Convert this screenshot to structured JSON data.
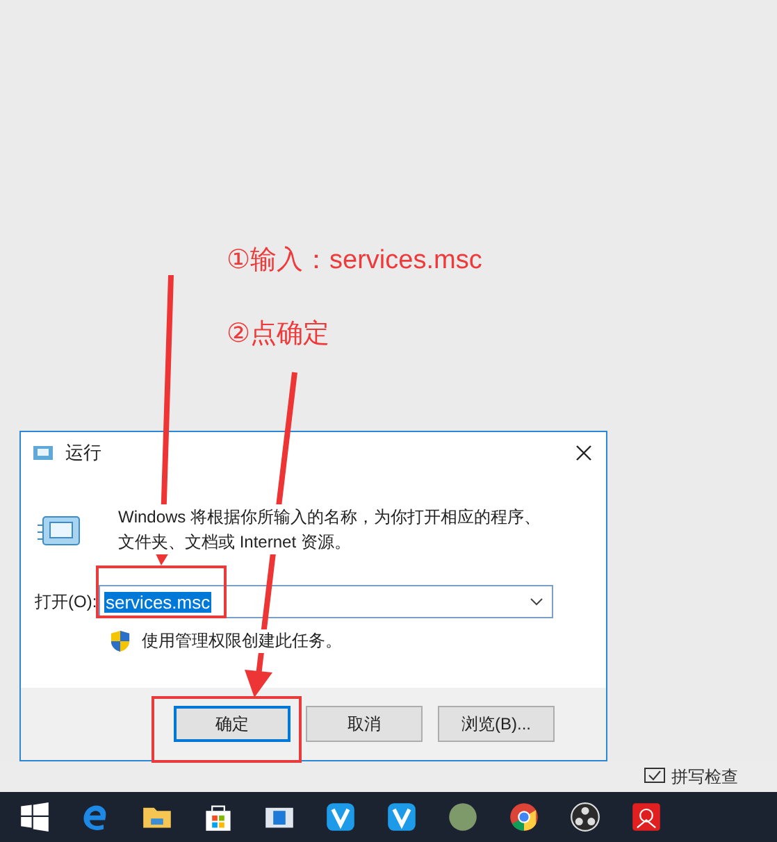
{
  "annotations": [
    {
      "text": "①输入：services.msc"
    },
    {
      "text": "②点确定"
    }
  ],
  "dialog": {
    "title": "运行",
    "description": "Windows 将根据你所输入的名称，为你打开相应的程序、文件夹、文档或 Internet 资源。",
    "open_label": "打开(O):",
    "input_value": "services.msc",
    "admin_note": "使用管理权限创建此任务。",
    "buttons": [
      {
        "label": "确定",
        "selected": true
      },
      {
        "label": "取消",
        "selected": false
      },
      {
        "label": "浏览(B)...",
        "selected": false
      }
    ]
  },
  "status_bar": {
    "items": [
      "拼写检查"
    ]
  }
}
